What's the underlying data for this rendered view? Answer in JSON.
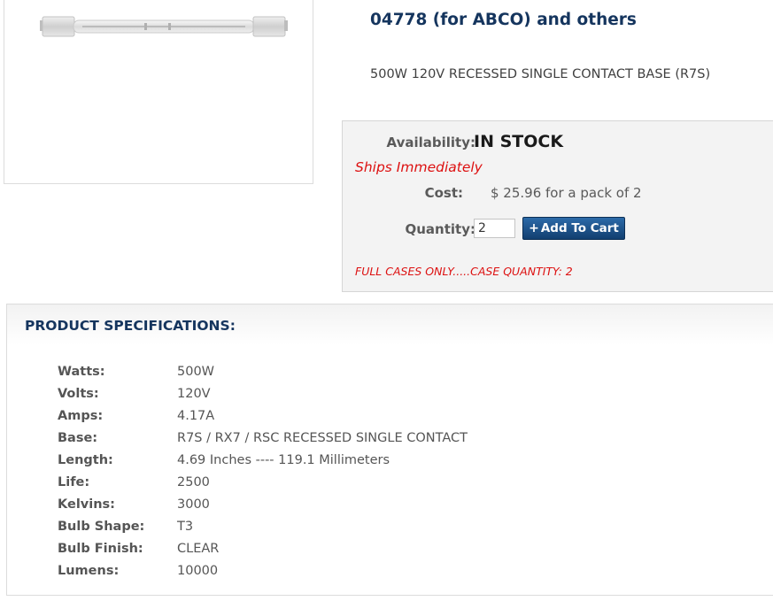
{
  "product": {
    "title": "04778  (for ABCO)  and others",
    "description": "500W 120V RECESSED SINGLE CONTACT BASE (R7S)",
    "image_icon": "halogen-bulb-image"
  },
  "purchase": {
    "availability_label": "Availability:",
    "availability_value": "IN STOCK",
    "ships_text": "Ships Immediately",
    "cost_label": "Cost:",
    "cost_value": "$ 25.96 for a pack of 2",
    "quantity_label": "Quantity:",
    "quantity_value": "2",
    "add_to_cart_label": "Add To Cart",
    "add_to_cart_icon": "+",
    "full_cases_text": "FULL CASES ONLY.....CASE QUANTITY: 2",
    "colors": {
      "ships": "#dd1111",
      "button": "#1a4d85",
      "title": "#15355e"
    }
  },
  "specs": {
    "title": "PRODUCT SPECIFICATIONS:",
    "rows": [
      {
        "label": "Watts:",
        "value": "500W"
      },
      {
        "label": "Volts:",
        "value": "120V"
      },
      {
        "label": "Amps:",
        "value": "4.17A"
      },
      {
        "label": "Base:",
        "value": "R7S / RX7 / RSC RECESSED SINGLE CONTACT"
      },
      {
        "label": "Length:",
        "value": "4.69 Inches ---- 119.1 Millimeters"
      },
      {
        "label": "Life:",
        "value": "2500"
      },
      {
        "label": "Kelvins:",
        "value": "3000"
      },
      {
        "label": "Bulb Shape:",
        "value": "T3"
      },
      {
        "label": "Bulb Finish:",
        "value": "CLEAR"
      },
      {
        "label": "Lumens:",
        "value": "10000"
      }
    ]
  }
}
